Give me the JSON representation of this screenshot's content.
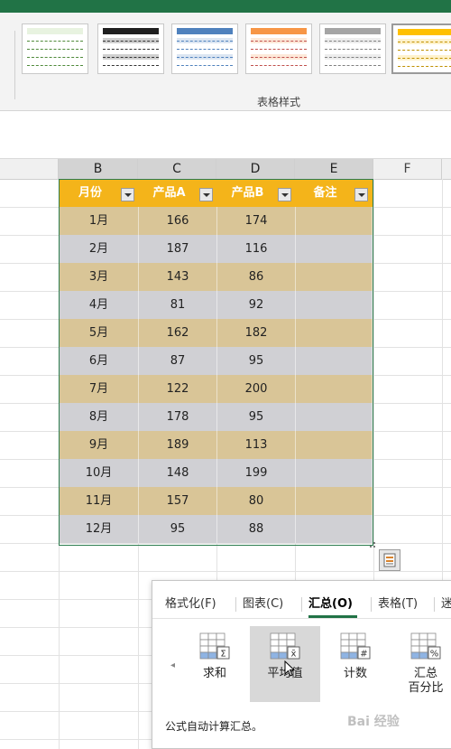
{
  "ribbon": {
    "group_label": "表格样式",
    "styles": [
      {
        "name": "green-style",
        "header": "#e8f3e0",
        "band": "#ffffff",
        "dash": "#4f8a3a"
      },
      {
        "name": "black-style",
        "header": "#1f1f1f",
        "band": "#d0d0d0",
        "dash": "#333333"
      },
      {
        "name": "blue-style",
        "header": "#4f81bd",
        "band": "#dce6f2",
        "dash": "#4f81bd"
      },
      {
        "name": "orange-style",
        "header": "#f79646",
        "band": "#fde9d9",
        "dash": "#c0504d"
      },
      {
        "name": "gray-style",
        "header": "#a5a5a5",
        "band": "#ededed",
        "dash": "#7f7f7f"
      },
      {
        "name": "gold-style",
        "header": "#ffc000",
        "band": "#fff2cc",
        "dash": "#bf9000"
      }
    ]
  },
  "columns": [
    {
      "label": "B",
      "selected": true
    },
    {
      "label": "C",
      "selected": true
    },
    {
      "label": "D",
      "selected": true
    },
    {
      "label": "E",
      "selected": true
    },
    {
      "label": "F",
      "selected": false
    }
  ],
  "table": {
    "header_color": "#f4b41a",
    "odd_row_color": "#d9c597",
    "even_row_color": "#d0d0d4",
    "headers": [
      "月份",
      "产品A",
      "产品B",
      "备注"
    ],
    "rows": [
      [
        "1月",
        "166",
        "174",
        ""
      ],
      [
        "2月",
        "187",
        "116",
        ""
      ],
      [
        "3月",
        "143",
        "86",
        ""
      ],
      [
        "4月",
        "81",
        "92",
        ""
      ],
      [
        "5月",
        "162",
        "182",
        ""
      ],
      [
        "6月",
        "87",
        "95",
        ""
      ],
      [
        "7月",
        "122",
        "200",
        ""
      ],
      [
        "8月",
        "178",
        "95",
        ""
      ],
      [
        "9月",
        "189",
        "113",
        ""
      ],
      [
        "10月",
        "148",
        "199",
        ""
      ],
      [
        "11月",
        "157",
        "80",
        ""
      ],
      [
        "12月",
        "95",
        "88",
        ""
      ]
    ]
  },
  "quick_analysis": {
    "tabs": [
      {
        "label": "格式化(F)",
        "active": false
      },
      {
        "label": "图表(C)",
        "active": false
      },
      {
        "label": "汇总(O)",
        "active": true
      },
      {
        "label": "表格(T)",
        "active": false
      },
      {
        "label": "迷",
        "active": false
      }
    ],
    "items": [
      {
        "label": "求和",
        "icon": "sum-icon",
        "symbol": "Σ"
      },
      {
        "label": "平均值",
        "icon": "average-icon",
        "symbol": "x̄"
      },
      {
        "label": "计数",
        "icon": "count-icon",
        "symbol": "#"
      },
      {
        "label": "汇总\n百分比",
        "icon": "percent-total-icon",
        "symbol": "%"
      }
    ],
    "scroll_left": "◂",
    "description": "公式自动计算汇总。"
  },
  "watermark": "Bai 经验"
}
